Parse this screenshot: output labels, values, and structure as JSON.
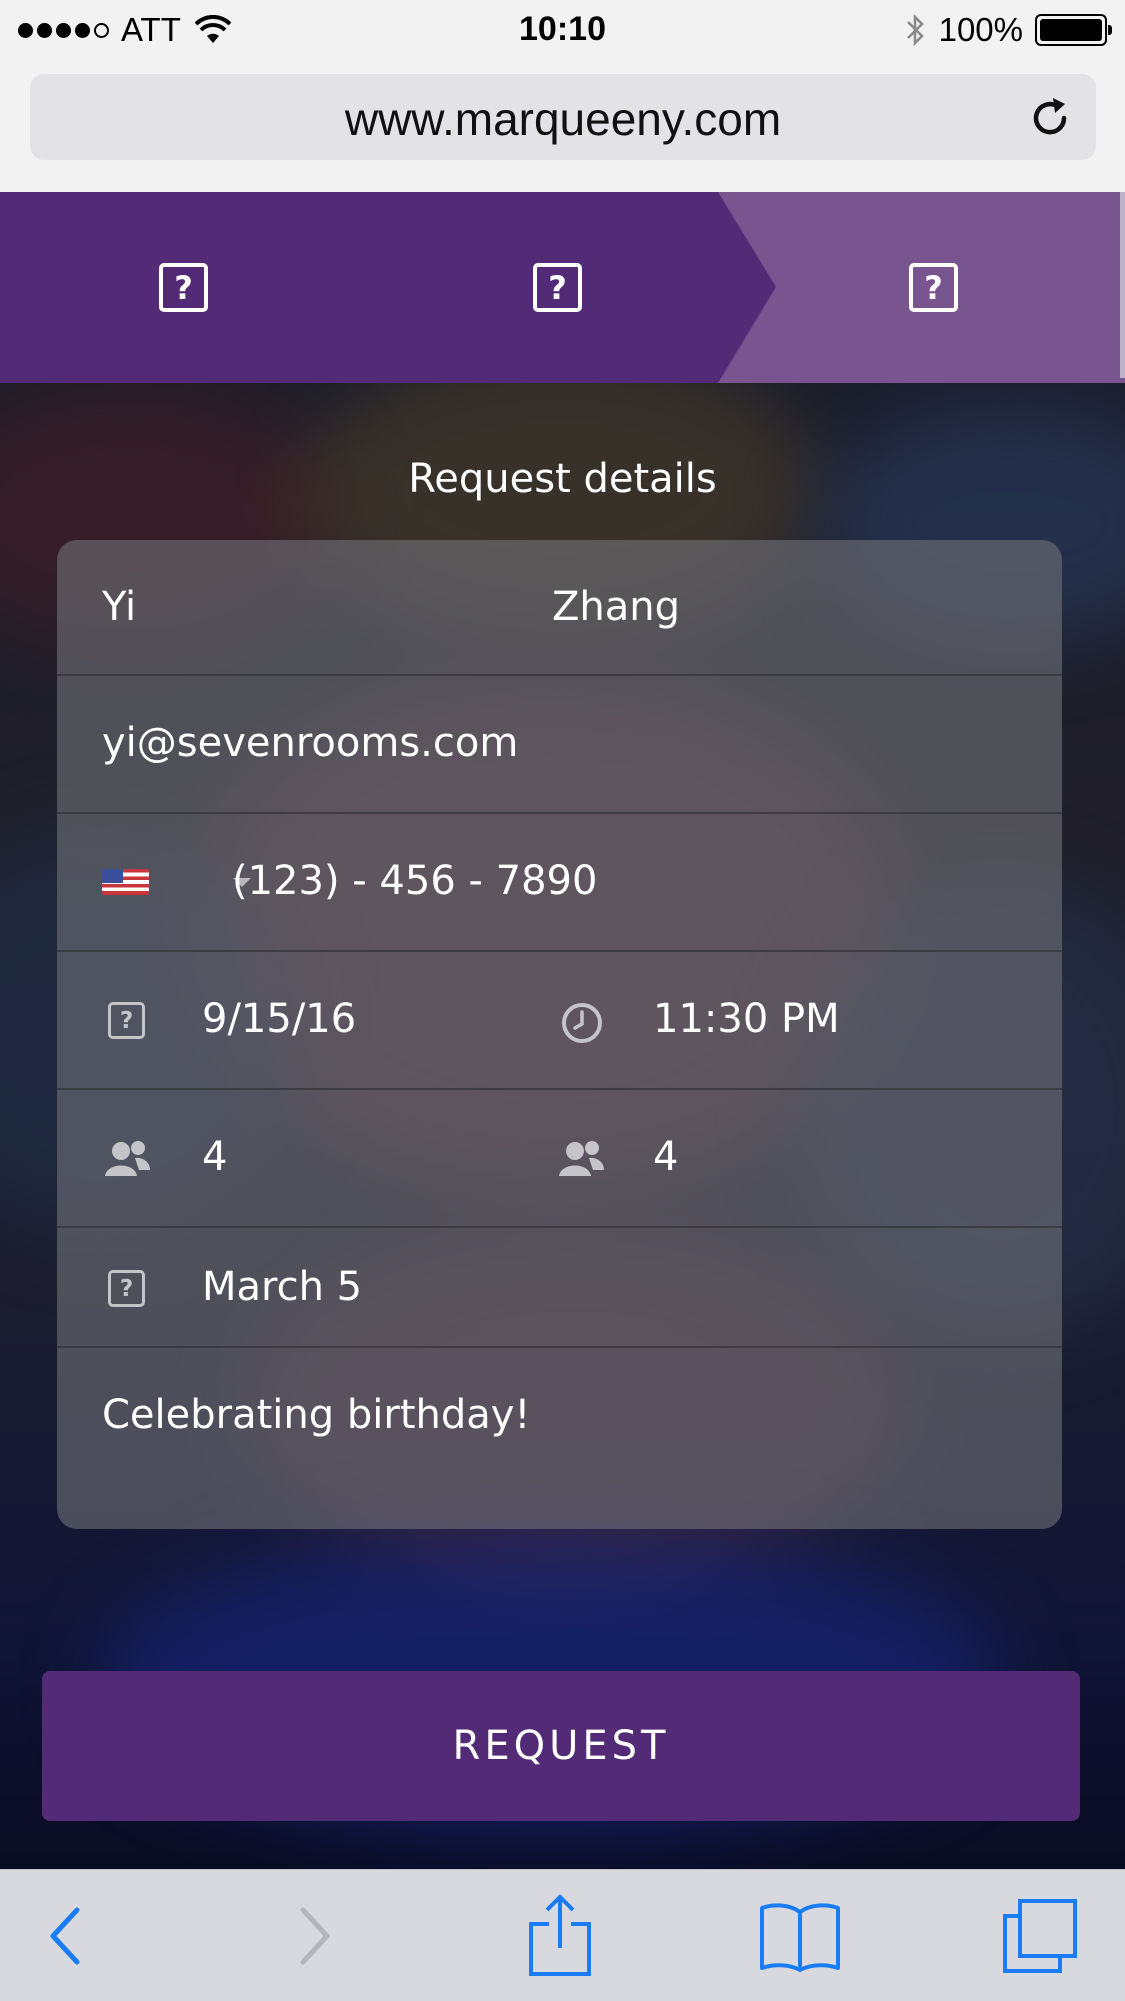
{
  "status_bar": {
    "carrier": "ATT",
    "time": "10:10",
    "battery": "100%"
  },
  "url_bar": {
    "url": "www.marqueeny.com"
  },
  "steps": [
    {
      "icon": "?"
    },
    {
      "icon": "?"
    },
    {
      "icon": "?"
    }
  ],
  "form": {
    "title": "Request details",
    "first_name": "Yi",
    "last_name": "Zhang",
    "email": "yi@sevenrooms.com",
    "phone": "(123) - 456 - 7890",
    "date": "9/15/16",
    "time": "11:30 PM",
    "party_size_1": "4",
    "party_size_2": "4",
    "occasion_date": "March 5",
    "notes": "Celebrating birthday!"
  },
  "request_button": "REQUEST",
  "colors": {
    "brand_purple": "#522a76",
    "step_active": "#79558f"
  }
}
